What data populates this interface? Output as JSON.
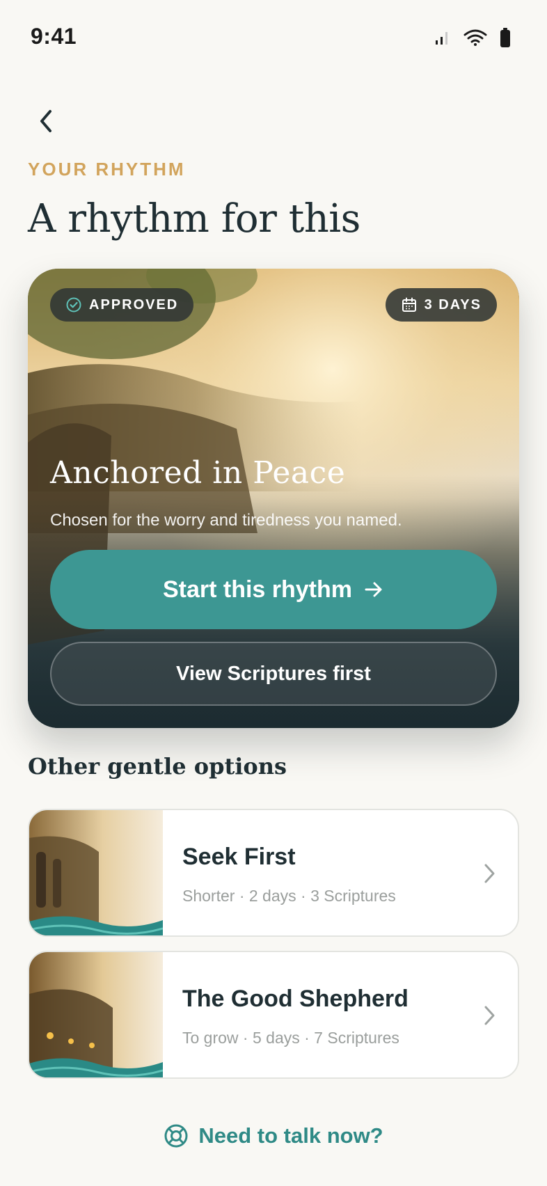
{
  "status_bar": {
    "time": "9:41"
  },
  "header": {
    "eyebrow": "YOUR RHYTHM",
    "title": "A rhythm for this"
  },
  "hero": {
    "badge_approved": "APPROVED",
    "badge_days": "3 DAYS",
    "title": "Anchored in Peace",
    "subtitle": "Chosen for the worry and tiredness you named.",
    "primary_label": "Start this rhythm",
    "secondary_label": "View Scriptures first"
  },
  "other": {
    "title": "Other gentle options",
    "items": [
      {
        "title": "Seek First",
        "meta": "Shorter · 2 days · 3 Scriptures"
      },
      {
        "title": "The Good Shepherd",
        "meta": "To grow · 5 days · 7 Scriptures"
      }
    ]
  },
  "help": {
    "label": "Need to talk now?"
  },
  "colors": {
    "accent_teal": "#3d9793",
    "eyebrow_gold": "#d2a45c",
    "link_teal": "#2f8a86",
    "background": "#f9f8f4"
  }
}
